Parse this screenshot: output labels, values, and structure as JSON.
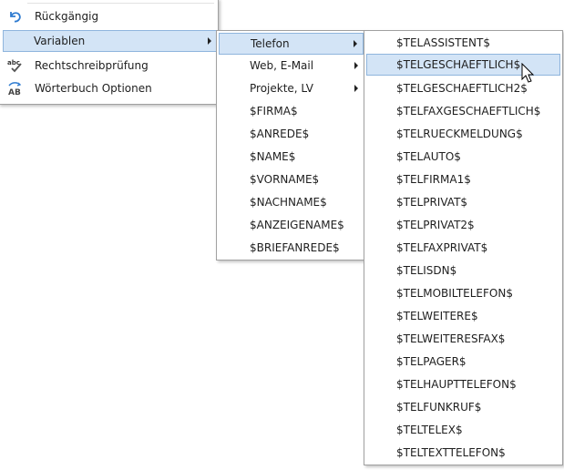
{
  "menu1": {
    "items": [
      {
        "label": "Rückgängig",
        "icon": "undo-icon"
      },
      {
        "label": "Variablen",
        "icon": "",
        "submenu": true
      },
      {
        "label": "Rechtschreibprüfung",
        "icon": "spellcheck-icon"
      },
      {
        "label": "Wörterbuch Optionen",
        "icon": "dictionary-icon"
      }
    ]
  },
  "menu2": {
    "items": [
      {
        "label": "Telefon",
        "submenu": true
      },
      {
        "label": "Web, E-Mail",
        "submenu": true
      },
      {
        "label": "Projekte, LV",
        "submenu": true
      },
      {
        "label": "$FIRMA$"
      },
      {
        "label": "$ANREDE$"
      },
      {
        "label": "$NAME$"
      },
      {
        "label": "$VORNAME$"
      },
      {
        "label": "$NACHNAME$"
      },
      {
        "label": "$ANZEIGENAME$"
      },
      {
        "label": "$BRIEFANREDE$"
      }
    ]
  },
  "menu3": {
    "items": [
      {
        "label": "$TELASSISTENT$"
      },
      {
        "label": "$TELGESCHAEFTLICH$"
      },
      {
        "label": "$TELGESCHAEFTLICH2$"
      },
      {
        "label": "$TELFAXGESCHAEFTLICH$"
      },
      {
        "label": "$TELRUECKMELDUNG$"
      },
      {
        "label": "$TELAUTO$"
      },
      {
        "label": "$TELFIRMA1$"
      },
      {
        "label": "$TELPRIVAT$"
      },
      {
        "label": "$TELPRIVAT2$"
      },
      {
        "label": "$TELFAXPRIVAT$"
      },
      {
        "label": "$TELISDN$"
      },
      {
        "label": "$TELMOBILTELEFON$"
      },
      {
        "label": "$TELWEITERE$"
      },
      {
        "label": "$TELWEITERESFAX$"
      },
      {
        "label": "$TELPAGER$"
      },
      {
        "label": "$TELHAUPTTELEFON$"
      },
      {
        "label": "$TELFUNKRUF$"
      },
      {
        "label": "$TELTELEX$"
      },
      {
        "label": "$TELTEXTTELEFON$"
      }
    ]
  },
  "colors": {
    "highlight": "#d3e4f6",
    "highlight_border": "#8fb5dd",
    "menu_border": "#a0a0a0"
  }
}
